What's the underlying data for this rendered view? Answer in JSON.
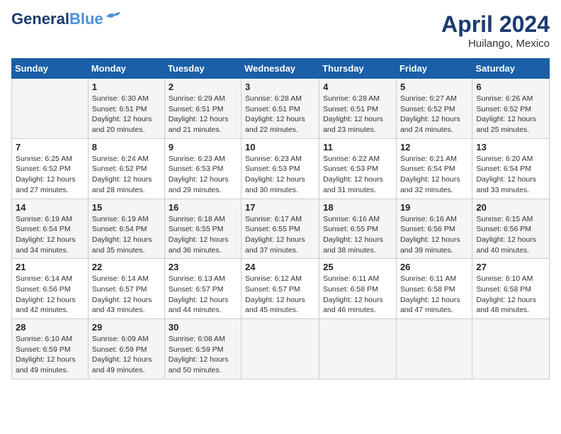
{
  "header": {
    "logo_line1": "General",
    "logo_line2": "Blue",
    "month": "April 2024",
    "location": "Huilango, Mexico"
  },
  "weekdays": [
    "Sunday",
    "Monday",
    "Tuesday",
    "Wednesday",
    "Thursday",
    "Friday",
    "Saturday"
  ],
  "weeks": [
    [
      {
        "day": "",
        "info": ""
      },
      {
        "day": "1",
        "info": "Sunrise: 6:30 AM\nSunset: 6:51 PM\nDaylight: 12 hours\nand 20 minutes."
      },
      {
        "day": "2",
        "info": "Sunrise: 6:29 AM\nSunset: 6:51 PM\nDaylight: 12 hours\nand 21 minutes."
      },
      {
        "day": "3",
        "info": "Sunrise: 6:28 AM\nSunset: 6:51 PM\nDaylight: 12 hours\nand 22 minutes."
      },
      {
        "day": "4",
        "info": "Sunrise: 6:28 AM\nSunset: 6:51 PM\nDaylight: 12 hours\nand 23 minutes."
      },
      {
        "day": "5",
        "info": "Sunrise: 6:27 AM\nSunset: 6:52 PM\nDaylight: 12 hours\nand 24 minutes."
      },
      {
        "day": "6",
        "info": "Sunrise: 6:26 AM\nSunset: 6:52 PM\nDaylight: 12 hours\nand 25 minutes."
      }
    ],
    [
      {
        "day": "7",
        "info": "Sunrise: 6:25 AM\nSunset: 6:52 PM\nDaylight: 12 hours\nand 27 minutes."
      },
      {
        "day": "8",
        "info": "Sunrise: 6:24 AM\nSunset: 6:52 PM\nDaylight: 12 hours\nand 28 minutes."
      },
      {
        "day": "9",
        "info": "Sunrise: 6:23 AM\nSunset: 6:53 PM\nDaylight: 12 hours\nand 29 minutes."
      },
      {
        "day": "10",
        "info": "Sunrise: 6:23 AM\nSunset: 6:53 PM\nDaylight: 12 hours\nand 30 minutes."
      },
      {
        "day": "11",
        "info": "Sunrise: 6:22 AM\nSunset: 6:53 PM\nDaylight: 12 hours\nand 31 minutes."
      },
      {
        "day": "12",
        "info": "Sunrise: 6:21 AM\nSunset: 6:54 PM\nDaylight: 12 hours\nand 32 minutes."
      },
      {
        "day": "13",
        "info": "Sunrise: 6:20 AM\nSunset: 6:54 PM\nDaylight: 12 hours\nand 33 minutes."
      }
    ],
    [
      {
        "day": "14",
        "info": "Sunrise: 6:19 AM\nSunset: 6:54 PM\nDaylight: 12 hours\nand 34 minutes."
      },
      {
        "day": "15",
        "info": "Sunrise: 6:19 AM\nSunset: 6:54 PM\nDaylight: 12 hours\nand 35 minutes."
      },
      {
        "day": "16",
        "info": "Sunrise: 6:18 AM\nSunset: 6:55 PM\nDaylight: 12 hours\nand 36 minutes."
      },
      {
        "day": "17",
        "info": "Sunrise: 6:17 AM\nSunset: 6:55 PM\nDaylight: 12 hours\nand 37 minutes."
      },
      {
        "day": "18",
        "info": "Sunrise: 6:16 AM\nSunset: 6:55 PM\nDaylight: 12 hours\nand 38 minutes."
      },
      {
        "day": "19",
        "info": "Sunrise: 6:16 AM\nSunset: 6:56 PM\nDaylight: 12 hours\nand 39 minutes."
      },
      {
        "day": "20",
        "info": "Sunrise: 6:15 AM\nSunset: 6:56 PM\nDaylight: 12 hours\nand 40 minutes."
      }
    ],
    [
      {
        "day": "21",
        "info": "Sunrise: 6:14 AM\nSunset: 6:56 PM\nDaylight: 12 hours\nand 42 minutes."
      },
      {
        "day": "22",
        "info": "Sunrise: 6:14 AM\nSunset: 6:57 PM\nDaylight: 12 hours\nand 43 minutes."
      },
      {
        "day": "23",
        "info": "Sunrise: 6:13 AM\nSunset: 6:57 PM\nDaylight: 12 hours\nand 44 minutes."
      },
      {
        "day": "24",
        "info": "Sunrise: 6:12 AM\nSunset: 6:57 PM\nDaylight: 12 hours\nand 45 minutes."
      },
      {
        "day": "25",
        "info": "Sunrise: 6:11 AM\nSunset: 6:58 PM\nDaylight: 12 hours\nand 46 minutes."
      },
      {
        "day": "26",
        "info": "Sunrise: 6:11 AM\nSunset: 6:58 PM\nDaylight: 12 hours\nand 47 minutes."
      },
      {
        "day": "27",
        "info": "Sunrise: 6:10 AM\nSunset: 6:58 PM\nDaylight: 12 hours\nand 48 minutes."
      }
    ],
    [
      {
        "day": "28",
        "info": "Sunrise: 6:10 AM\nSunset: 6:59 PM\nDaylight: 12 hours\nand 49 minutes."
      },
      {
        "day": "29",
        "info": "Sunrise: 6:09 AM\nSunset: 6:59 PM\nDaylight: 12 hours\nand 49 minutes."
      },
      {
        "day": "30",
        "info": "Sunrise: 6:08 AM\nSunset: 6:59 PM\nDaylight: 12 hours\nand 50 minutes."
      },
      {
        "day": "",
        "info": ""
      },
      {
        "day": "",
        "info": ""
      },
      {
        "day": "",
        "info": ""
      },
      {
        "day": "",
        "info": ""
      }
    ]
  ]
}
